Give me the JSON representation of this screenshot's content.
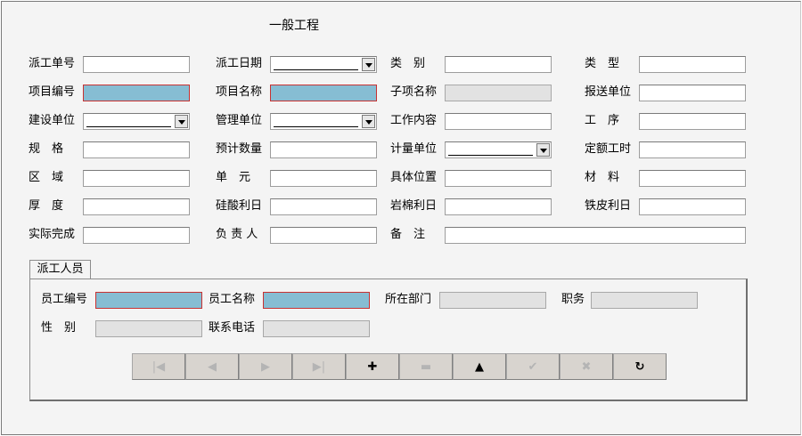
{
  "title": "一般工程",
  "form": {
    "dispatch_no_label": "派工单号",
    "dispatch_date_label": "派工日期",
    "category_label": "类　别",
    "type_label": "类　型",
    "project_code_label": "项目编号",
    "project_name_label": "项目名称",
    "subitem_name_label": "子项名称",
    "report_unit_label": "报送单位",
    "construction_unit_label": "建设单位",
    "management_unit_label": "管理单位",
    "work_content_label": "工作内容",
    "process_label": "工　序",
    "spec_label": "规　格",
    "est_qty_label": "预计数量",
    "unit_label": "计量单位",
    "quota_hours_label": "定额工时",
    "area_label": "区　域",
    "unit2_label": "单　元",
    "location_label": "具体位置",
    "material_label": "材　料",
    "thickness_label": "厚　度",
    "silicate_label": "硅酸利日",
    "rockwool_label": "岩棉利日",
    "iron_label": "铁皮利日",
    "actual_label": "实际完成",
    "owner_label": "负 责 人",
    "remark_label": "备　注"
  },
  "tab_label": "派工人员",
  "staff": {
    "emp_no_label": "员工编号",
    "emp_name_label": "员工名称",
    "dept_label": "所在部门",
    "position_label": "职务",
    "gender_label": "性　别",
    "phone_label": "联系电话"
  },
  "nav_buttons": [
    {
      "icon": "first-record-icon",
      "glyph": "|◀",
      "enabled": false
    },
    {
      "icon": "prior-record-icon",
      "glyph": "◀",
      "enabled": false
    },
    {
      "icon": "next-record-icon",
      "glyph": "▶",
      "enabled": false
    },
    {
      "icon": "last-record-icon",
      "glyph": "▶|",
      "enabled": false
    },
    {
      "icon": "insert-icon",
      "glyph": "✚",
      "enabled": true
    },
    {
      "icon": "delete-icon",
      "glyph": "▬",
      "enabled": false
    },
    {
      "icon": "edit-icon",
      "glyph": "▲",
      "enabled": true
    },
    {
      "icon": "post-icon",
      "glyph": "✔",
      "enabled": false
    },
    {
      "icon": "cancel-icon",
      "glyph": "✖",
      "enabled": false
    },
    {
      "icon": "refresh-icon",
      "glyph": "↻",
      "enabled": true
    }
  ],
  "colors": {
    "required_bg": "#86bdd3",
    "required_border": "#c83232",
    "disabled_bg": "#e2e2e2"
  }
}
